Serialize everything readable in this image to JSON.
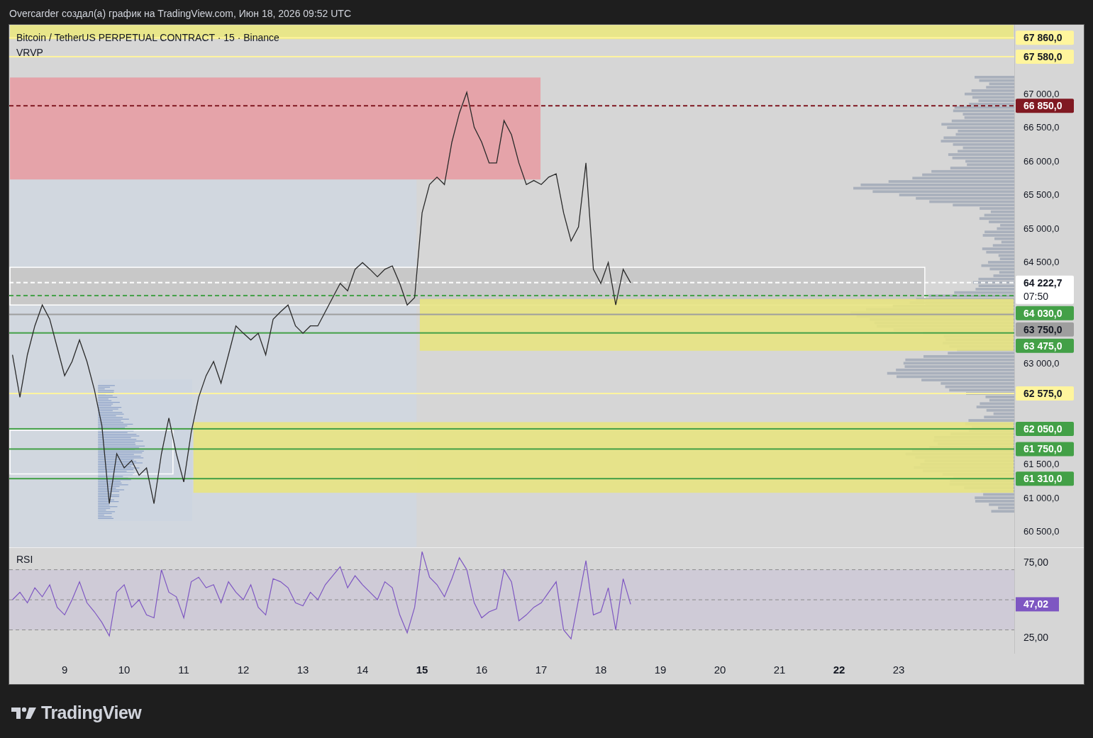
{
  "header": {
    "text": "Overcarder создал(а) график на TradingView.com, Июн 18, 2026 09:52 UTC"
  },
  "chart": {
    "legend": {
      "symbol": "Bitcoin / TetherUS PERPETUAL CONTRACT · 15 · Binance",
      "indicator": "VRVP"
    },
    "countdown": "07:50",
    "chart_data": {
      "type": "line",
      "xlim": [
        8.07,
        24.94
      ],
      "ylim": [
        60290,
        68053
      ],
      "x": [
        8.125,
        8.25,
        8.375,
        8.5,
        8.625,
        8.75,
        8.875,
        9,
        9.125,
        9.25,
        9.375,
        9.5,
        9.625,
        9.75,
        9.875,
        10,
        10.125,
        10.25,
        10.375,
        10.5,
        10.625,
        10.75,
        10.875,
        11,
        11.125,
        11.25,
        11.375,
        11.5,
        11.625,
        11.75,
        11.875,
        12,
        12.125,
        12.25,
        12.375,
        12.5,
        12.625,
        12.75,
        12.875,
        13,
        13.125,
        13.25,
        13.375,
        13.5,
        13.625,
        13.75,
        13.875,
        14,
        14.125,
        14.25,
        14.375,
        14.5,
        14.625,
        14.75,
        14.875,
        15,
        15.125,
        15.25,
        15.375,
        15.5,
        15.625,
        15.75,
        15.875,
        16,
        16.125,
        16.25,
        16.375,
        16.5,
        16.625,
        16.75,
        16.875,
        17,
        17.125,
        17.25,
        17.375,
        17.5,
        17.625,
        17.75,
        17.875,
        18,
        18.125,
        18.25,
        18.375,
        18.5
      ],
      "series": [
        {
          "color": "#2a2a2a",
          "values": [
            63150,
            62520,
            63150,
            63580,
            63890,
            63680,
            63260,
            62840,
            63050,
            63370,
            63050,
            62630,
            62100,
            60940,
            61680,
            61470,
            61580,
            61360,
            61470,
            60940,
            61680,
            62210,
            61680,
            61260,
            62000,
            62520,
            62840,
            63050,
            62730,
            63150,
            63580,
            63470,
            63370,
            63470,
            63150,
            63680,
            63790,
            63890,
            63580,
            63470,
            63580,
            63580,
            63790,
            64000,
            64210,
            64100,
            64420,
            64520,
            64420,
            64310,
            64420,
            64470,
            64210,
            63890,
            64000,
            65260,
            65680,
            65790,
            65680,
            66310,
            66740,
            67050,
            66530,
            66310,
            66000,
            66000,
            66630,
            66420,
            66000,
            65680,
            65740,
            65680,
            65790,
            65840,
            65260,
            64840,
            65050,
            66000,
            64420,
            64210,
            64520,
            63890,
            64420,
            64220
          ]
        }
      ],
      "yticks": [
        {
          "value": 67000,
          "label": "67 000,0"
        },
        {
          "value": 66500,
          "label": "66 500,0"
        },
        {
          "value": 66000,
          "label": "66 000,0"
        },
        {
          "value": 65500,
          "label": "65 500,0"
        },
        {
          "value": 65000,
          "label": "65 000,0"
        },
        {
          "value": 64500,
          "label": "64 500,0"
        },
        {
          "value": 63000,
          "label": "63 000,0"
        },
        {
          "value": 61500,
          "label": "61 500,0"
        },
        {
          "value": 61000,
          "label": "61 000,0"
        },
        {
          "value": 60500,
          "label": "60 500,0"
        }
      ],
      "bands": [
        {
          "axis": "y",
          "from": 67840,
          "to": 68050,
          "color": "#e8e68a"
        }
      ],
      "ref_lines": [
        {
          "axis": "y",
          "value": 67860,
          "label": "67 860,0",
          "color": "#fff59d"
        },
        {
          "axis": "y",
          "value": 67580,
          "label": "67 580,0",
          "color": "#fff59d"
        },
        {
          "axis": "y",
          "value": 66850,
          "label": "66 850,0",
          "color": "#801922"
        },
        {
          "axis": "y",
          "value": 64222.7,
          "label": "64 222,7",
          "color": "#ffffff"
        },
        {
          "axis": "y",
          "value": 64030,
          "label": "64 030,0",
          "color": "#43a047"
        },
        {
          "axis": "y",
          "value": 63750,
          "label": "63 750,0",
          "color": "#9e9e9e"
        },
        {
          "axis": "y",
          "value": 63475,
          "label": "63 475,0",
          "color": "#43a047"
        },
        {
          "axis": "y",
          "value": 62575,
          "label": "62 575,0",
          "color": "#fff59d"
        },
        {
          "axis": "y",
          "value": 62050,
          "label": "62 050,0",
          "color": "#43a047"
        },
        {
          "axis": "y",
          "value": 61750,
          "label": "61 750,0",
          "color": "#43a047"
        },
        {
          "axis": "y",
          "value": 61310,
          "label": "61 310,0",
          "color": "#43a047"
        }
      ]
    },
    "level_lines": [
      {
        "dashed": false
      },
      {
        "dashed": false
      },
      {
        "dashed": true
      },
      {
        "dashed": true
      },
      {
        "dashed": true
      },
      {
        "dashed": false
      },
      {
        "dashed": false
      },
      {
        "dashed": false
      },
      {
        "dashed": false
      },
      {
        "dashed": false
      },
      {
        "dashed": false
      }
    ]
  },
  "rsi_pane": {
    "value_tag": {
      "label": "47,02"
    },
    "chart_data": {
      "type": "line",
      "xlim": [
        8.07,
        24.94
      ],
      "ylim": [
        14.2,
        84.9
      ],
      "x": [
        8.125,
        8.25,
        8.375,
        8.5,
        8.625,
        8.75,
        8.875,
        9,
        9.125,
        9.25,
        9.375,
        9.5,
        9.625,
        9.75,
        9.875,
        10,
        10.125,
        10.25,
        10.375,
        10.5,
        10.625,
        10.75,
        10.875,
        11,
        11.125,
        11.25,
        11.375,
        11.5,
        11.625,
        11.75,
        11.875,
        12,
        12.125,
        12.25,
        12.375,
        12.5,
        12.625,
        12.75,
        12.875,
        13,
        13.125,
        13.25,
        13.375,
        13.5,
        13.625,
        13.75,
        13.875,
        14,
        14.125,
        14.25,
        14.375,
        14.5,
        14.625,
        14.75,
        14.875,
        15,
        15.125,
        15.25,
        15.375,
        15.5,
        15.625,
        15.75,
        15.875,
        16,
        16.125,
        16.25,
        16.375,
        16.5,
        16.625,
        16.75,
        16.875,
        17,
        17.125,
        17.25,
        17.375,
        17.5,
        17.625,
        17.75,
        17.875,
        18,
        18.125,
        18.25,
        18.375,
        18.5
      ],
      "series": [
        {
          "name": "RSI",
          "color": "#7e57c2",
          "values": [
            50,
            55,
            48,
            58,
            52,
            60,
            45,
            40,
            50,
            62,
            48,
            42,
            35,
            26,
            55,
            60,
            45,
            50,
            40,
            38,
            70,
            55,
            52,
            38,
            62,
            65,
            58,
            60,
            48,
            62,
            55,
            50,
            60,
            45,
            40,
            64,
            62,
            58,
            48,
            46,
            55,
            50,
            60,
            66,
            72,
            58,
            66,
            60,
            55,
            50,
            62,
            58,
            40,
            28,
            45,
            82,
            65,
            60,
            52,
            64,
            78,
            70,
            48,
            38,
            42,
            44,
            70,
            62,
            36,
            40,
            45,
            48,
            55,
            62,
            30,
            24,
            50,
            76,
            40,
            42,
            58,
            30,
            64,
            47
          ]
        }
      ],
      "xticks": [
        9,
        10,
        11,
        12,
        13,
        14,
        15,
        16,
        17,
        18,
        19,
        20,
        21,
        22,
        23
      ],
      "yticks": [
        {
          "value": 75,
          "label": "75,00"
        },
        {
          "value": 25,
          "label": "25,00"
        }
      ],
      "bands": [
        {
          "axis": "y",
          "from": 30,
          "to": 70,
          "color": "#cfcbd7"
        }
      ],
      "ref_lines": [
        {
          "axis": "y",
          "value": 70,
          "color": "#8c8c8c"
        },
        {
          "axis": "y",
          "value": 50,
          "color": "#8c8c8c"
        },
        {
          "axis": "y",
          "value": 30,
          "color": "#8c8c8c"
        }
      ]
    }
  },
  "time_axis": [
    {
      "label": "9",
      "bold": false
    },
    {
      "label": "10",
      "bold": false
    },
    {
      "label": "11",
      "bold": false
    },
    {
      "label": "12",
      "bold": false
    },
    {
      "label": "13",
      "bold": false
    },
    {
      "label": "14",
      "bold": false
    },
    {
      "label": "15",
      "bold": true
    },
    {
      "label": "16",
      "bold": false
    },
    {
      "label": "17",
      "bold": false
    },
    {
      "label": "18",
      "bold": false
    },
    {
      "label": "19",
      "bold": false
    },
    {
      "label": "20",
      "bold": false
    },
    {
      "label": "21",
      "bold": false
    },
    {
      "label": "22",
      "bold": true
    },
    {
      "label": "23",
      "bold": false
    }
  ],
  "footer": {
    "logo_text": "TradingView"
  }
}
